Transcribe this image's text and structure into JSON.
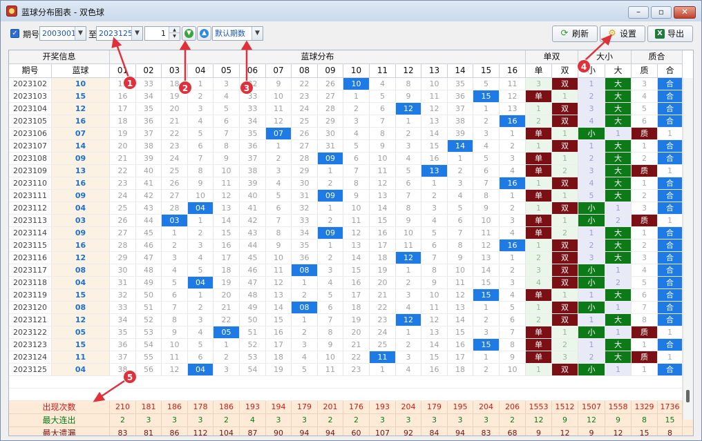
{
  "window": {
    "title": "蓝球分布图表 - 双色球",
    "min": "–",
    "max": "▫",
    "close": "✕"
  },
  "toolbar": {
    "period_label": "期号",
    "from_value": "2003001",
    "to_label": "至",
    "to_value": "2023125",
    "spin_value": "1",
    "default_periods": "默认期数",
    "refresh_label": "刷新",
    "settings_label": "设置",
    "export_label": "导出"
  },
  "headers": {
    "group_info": "开奖信息",
    "group_dist": "蓝球分布",
    "group_ds": "单双",
    "group_dx": "大小",
    "group_zh": "质合",
    "period": "期号",
    "blue": "蓝球",
    "nums": [
      "01",
      "02",
      "03",
      "04",
      "05",
      "06",
      "07",
      "08",
      "09",
      "10",
      "11",
      "12",
      "13",
      "14",
      "15",
      "16"
    ],
    "dan": "单",
    "shuang": "双",
    "xiao": "小",
    "da": "大",
    "zhi": "质",
    "he": "合"
  },
  "rows": [
    {
      "p": "2023102",
      "b": "10",
      "m": [
        "15",
        "33",
        "18",
        "1",
        "3",
        "32",
        "9",
        "22",
        "26",
        "10",
        "4",
        "8",
        "10",
        "35",
        "5",
        "11"
      ],
      "ds": [
        "3",
        "双"
      ],
      "dx": [
        "1",
        "大"
      ],
      "zh": [
        "3",
        "合"
      ]
    },
    {
      "p": "2023103",
      "b": "15",
      "m": [
        "16",
        "34",
        "19",
        "2",
        "4",
        "33",
        "10",
        "23",
        "27",
        "1",
        "5",
        "9",
        "11",
        "36",
        "15",
        "12"
      ],
      "ds": [
        "单",
        "1"
      ],
      "dx": [
        "2",
        "大"
      ],
      "zh": [
        "4",
        "合"
      ]
    },
    {
      "p": "2023104",
      "b": "12",
      "m": [
        "17",
        "35",
        "20",
        "3",
        "5",
        "33",
        "11",
        "24",
        "28",
        "2",
        "6",
        "12",
        "12",
        "37",
        "1",
        "13"
      ],
      "ds": [
        "1",
        "双"
      ],
      "dx": [
        "3",
        "大"
      ],
      "zh": [
        "5",
        "合"
      ]
    },
    {
      "p": "2023105",
      "b": "16",
      "m": [
        "18",
        "36",
        "21",
        "4",
        "6",
        "34",
        "12",
        "25",
        "29",
        "3",
        "7",
        "1",
        "13",
        "38",
        "2",
        "16"
      ],
      "ds": [
        "2",
        "双"
      ],
      "dx": [
        "4",
        "大"
      ],
      "zh": [
        "6",
        "合"
      ]
    },
    {
      "p": "2023106",
      "b": "07",
      "m": [
        "19",
        "37",
        "22",
        "5",
        "7",
        "35",
        "07",
        "26",
        "30",
        "4",
        "8",
        "2",
        "14",
        "39",
        "3",
        "1"
      ],
      "ds": [
        "单",
        "1"
      ],
      "dx": [
        "小",
        "1"
      ],
      "zh": [
        "质",
        "1"
      ]
    },
    {
      "p": "2023107",
      "b": "14",
      "m": [
        "20",
        "38",
        "23",
        "6",
        "8",
        "36",
        "1",
        "27",
        "31",
        "5",
        "9",
        "3",
        "15",
        "14",
        "4",
        "2"
      ],
      "ds": [
        "1",
        "双"
      ],
      "dx": [
        "1",
        "大"
      ],
      "zh": [
        "1",
        "合"
      ]
    },
    {
      "p": "2023108",
      "b": "09",
      "m": [
        "21",
        "39",
        "24",
        "7",
        "9",
        "37",
        "2",
        "28",
        "09",
        "6",
        "10",
        "4",
        "16",
        "1",
        "5",
        "3"
      ],
      "ds": [
        "单",
        "1"
      ],
      "dx": [
        "2",
        "大"
      ],
      "zh": [
        "2",
        "合"
      ]
    },
    {
      "p": "2023109",
      "b": "13",
      "m": [
        "22",
        "40",
        "25",
        "8",
        "10",
        "38",
        "3",
        "29",
        "1",
        "7",
        "11",
        "5",
        "13",
        "2",
        "6",
        "4"
      ],
      "ds": [
        "单",
        "2"
      ],
      "dx": [
        "3",
        "大"
      ],
      "zh": [
        "质",
        "1"
      ]
    },
    {
      "p": "2023110",
      "b": "16",
      "m": [
        "23",
        "41",
        "26",
        "9",
        "11",
        "39",
        "4",
        "30",
        "2",
        "8",
        "12",
        "6",
        "1",
        "3",
        "7",
        "16"
      ],
      "ds": [
        "1",
        "双"
      ],
      "dx": [
        "4",
        "大"
      ],
      "zh": [
        "1",
        "合"
      ]
    },
    {
      "p": "2023111",
      "b": "09",
      "m": [
        "24",
        "42",
        "27",
        "10",
        "12",
        "40",
        "5",
        "31",
        "09",
        "9",
        "13",
        "7",
        "2",
        "4",
        "8",
        "1"
      ],
      "ds": [
        "单",
        "1"
      ],
      "dx": [
        "5",
        "大"
      ],
      "zh": [
        "2",
        "合"
      ]
    },
    {
      "p": "2023112",
      "b": "04",
      "m": [
        "25",
        "43",
        "28",
        "04",
        "13",
        "41",
        "6",
        "32",
        "1",
        "10",
        "14",
        "8",
        "3",
        "5",
        "9",
        "2"
      ],
      "ds": [
        "1",
        "双"
      ],
      "dx": [
        "小",
        "1"
      ],
      "zh": [
        "3",
        "合"
      ]
    },
    {
      "p": "2023113",
      "b": "03",
      "m": [
        "26",
        "44",
        "03",
        "1",
        "14",
        "42",
        "7",
        "33",
        "2",
        "11",
        "15",
        "9",
        "4",
        "6",
        "10",
        "3"
      ],
      "ds": [
        "单",
        "1"
      ],
      "dx": [
        "小",
        "2"
      ],
      "zh": [
        "质",
        "1"
      ]
    },
    {
      "p": "2023114",
      "b": "09",
      "m": [
        "27",
        "45",
        "1",
        "2",
        "15",
        "43",
        "8",
        "34",
        "09",
        "12",
        "16",
        "10",
        "5",
        "7",
        "11",
        "4"
      ],
      "ds": [
        "单",
        "2"
      ],
      "dx": [
        "1",
        "大"
      ],
      "zh": [
        "1",
        "合"
      ]
    },
    {
      "p": "2023115",
      "b": "16",
      "m": [
        "28",
        "46",
        "2",
        "3",
        "16",
        "44",
        "9",
        "35",
        "1",
        "13",
        "17",
        "11",
        "6",
        "8",
        "12",
        "16"
      ],
      "ds": [
        "1",
        "双"
      ],
      "dx": [
        "2",
        "大"
      ],
      "zh": [
        "2",
        "合"
      ]
    },
    {
      "p": "2023116",
      "b": "12",
      "m": [
        "29",
        "47",
        "3",
        "4",
        "17",
        "45",
        "10",
        "36",
        "2",
        "14",
        "18",
        "12",
        "7",
        "9",
        "13",
        "1"
      ],
      "ds": [
        "2",
        "双"
      ],
      "dx": [
        "3",
        "大"
      ],
      "zh": [
        "3",
        "合"
      ]
    },
    {
      "p": "2023117",
      "b": "08",
      "m": [
        "30",
        "48",
        "4",
        "5",
        "18",
        "46",
        "11",
        "08",
        "3",
        "15",
        "19",
        "1",
        "8",
        "10",
        "14",
        "2"
      ],
      "ds": [
        "3",
        "双"
      ],
      "dx": [
        "小",
        "1"
      ],
      "zh": [
        "4",
        "合"
      ]
    },
    {
      "p": "2023118",
      "b": "04",
      "m": [
        "31",
        "49",
        "5",
        "04",
        "19",
        "47",
        "12",
        "1",
        "4",
        "16",
        "20",
        "2",
        "9",
        "11",
        "15",
        "3"
      ],
      "ds": [
        "4",
        "双"
      ],
      "dx": [
        "小",
        "2"
      ],
      "zh": [
        "5",
        "合"
      ]
    },
    {
      "p": "2023119",
      "b": "15",
      "m": [
        "32",
        "50",
        "6",
        "1",
        "20",
        "48",
        "13",
        "2",
        "5",
        "17",
        "21",
        "3",
        "10",
        "12",
        "15",
        "4"
      ],
      "ds": [
        "单",
        "1"
      ],
      "dx": [
        "1",
        "大"
      ],
      "zh": [
        "6",
        "合"
      ]
    },
    {
      "p": "2023120",
      "b": "08",
      "m": [
        "33",
        "51",
        "7",
        "2",
        "21",
        "49",
        "14",
        "08",
        "6",
        "18",
        "22",
        "4",
        "11",
        "13",
        "1",
        "5"
      ],
      "ds": [
        "1",
        "双"
      ],
      "dx": [
        "小",
        "1"
      ],
      "zh": [
        "7",
        "合"
      ]
    },
    {
      "p": "2023121",
      "b": "12",
      "m": [
        "34",
        "52",
        "8",
        "3",
        "22",
        "50",
        "15",
        "1",
        "7",
        "19",
        "23",
        "12",
        "12",
        "14",
        "2",
        "6"
      ],
      "ds": [
        "2",
        "双"
      ],
      "dx": [
        "1",
        "大"
      ],
      "zh": [
        "8",
        "合"
      ]
    },
    {
      "p": "2023122",
      "b": "05",
      "m": [
        "35",
        "53",
        "9",
        "4",
        "05",
        "51",
        "16",
        "2",
        "8",
        "20",
        "24",
        "1",
        "13",
        "15",
        "3",
        "7"
      ],
      "ds": [
        "单",
        "1"
      ],
      "dx": [
        "小",
        "1"
      ],
      "zh": [
        "质",
        "1"
      ]
    },
    {
      "p": "2023123",
      "b": "15",
      "m": [
        "36",
        "54",
        "10",
        "5",
        "1",
        "52",
        "17",
        "3",
        "9",
        "21",
        "25",
        "2",
        "14",
        "16",
        "15",
        "8"
      ],
      "ds": [
        "单",
        "2"
      ],
      "dx": [
        "1",
        "大"
      ],
      "zh": [
        "1",
        "合"
      ]
    },
    {
      "p": "2023124",
      "b": "11",
      "m": [
        "37",
        "55",
        "11",
        "6",
        "2",
        "53",
        "18",
        "4",
        "10",
        "22",
        "11",
        "3",
        "15",
        "17",
        "1",
        "9"
      ],
      "ds": [
        "单",
        "3"
      ],
      "dx": [
        "2",
        "大"
      ],
      "zh": [
        "质",
        "1"
      ]
    },
    {
      "p": "2023125",
      "b": "04",
      "m": [
        "38",
        "56",
        "12",
        "04",
        "3",
        "54",
        "19",
        "5",
        "11",
        "23",
        "1",
        "4",
        "16",
        "18",
        "2",
        "10"
      ],
      "ds": [
        "1",
        "双"
      ],
      "dx": [
        "小",
        "1"
      ],
      "zh": [
        "1",
        "合"
      ]
    }
  ],
  "summary": [
    {
      "label": "出现次数",
      "color": "#d01818",
      "vals": [
        "210",
        "181",
        "186",
        "178",
        "186",
        "193",
        "194",
        "179",
        "201",
        "176",
        "193",
        "204",
        "179",
        "195",
        "204",
        "206",
        "1553",
        "1512",
        "1507",
        "1558",
        "1329",
        "1736"
      ]
    },
    {
      "label": "最大连出",
      "color": "#0c7a17",
      "vals": [
        "2",
        "3",
        "3",
        "3",
        "2",
        "4",
        "3",
        "3",
        "2",
        "2",
        "3",
        "3",
        "3",
        "3",
        "3",
        "2",
        "12",
        "9",
        "12",
        "9",
        "8",
        "15"
      ]
    },
    {
      "label": "最大遗漏",
      "color": "#7a0f14",
      "vals": [
        "83",
        "81",
        "86",
        "112",
        "104",
        "87",
        "90",
        "94",
        "94",
        "60",
        "107",
        "92",
        "84",
        "94",
        "83",
        "68",
        "9",
        "12",
        "9",
        "12",
        "15",
        "8"
      ]
    }
  ],
  "callouts": [
    "1",
    "2",
    "3",
    "4",
    "5"
  ]
}
